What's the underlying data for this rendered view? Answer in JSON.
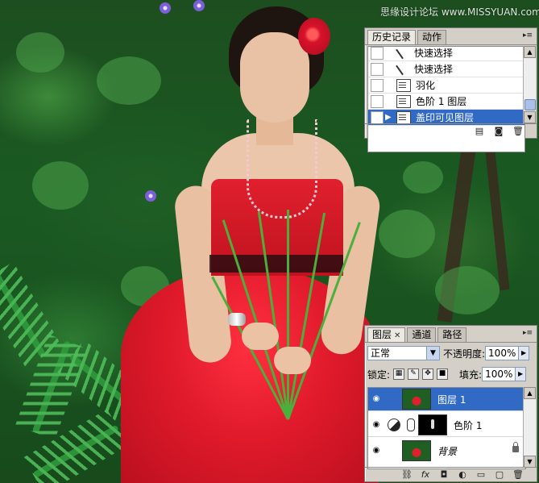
{
  "watermark": "思缘设计论坛 www.MISSYUAN.com",
  "history_panel": {
    "tabs": [
      {
        "label": "历史记录",
        "active": true
      },
      {
        "label": "动作",
        "active": false
      }
    ],
    "items": [
      {
        "label": "快速选择",
        "icon": "magic-wand-icon",
        "selected": false
      },
      {
        "label": "快速选择",
        "icon": "magic-wand-icon",
        "selected": false
      },
      {
        "label": "羽化",
        "icon": "history-state-icon",
        "selected": false
      },
      {
        "label": "色阶 1 图层",
        "icon": "history-state-icon",
        "selected": false
      },
      {
        "label": "盖印可见图层",
        "icon": "history-state-icon",
        "selected": true
      }
    ],
    "footer_icons": [
      "new-document-from-state-icon",
      "camera-snapshot-icon",
      "trash-icon"
    ]
  },
  "layers_panel": {
    "tabs": [
      {
        "label": "图层",
        "active": true,
        "closable": true
      },
      {
        "label": "通道",
        "active": false
      },
      {
        "label": "路径",
        "active": false
      }
    ],
    "blend_mode": "正常",
    "opacity_label": "不透明度:",
    "opacity_value": "100%",
    "lock_label": "锁定:",
    "fill_label": "填充:",
    "fill_value": "100%",
    "layers": [
      {
        "name": "图层 1",
        "selected": true,
        "visible": true
      },
      {
        "name": "色阶 1",
        "selected": false,
        "visible": true,
        "adjustment": true
      },
      {
        "name": "背景",
        "selected": false,
        "visible": true,
        "locked": true
      }
    ],
    "footer_icons": [
      "link-icon",
      "fx-icon",
      "mask-icon",
      "adjustment-icon",
      "group-folder-icon",
      "new-layer-icon",
      "trash-icon"
    ]
  },
  "colors": {
    "selection": "#316ac5",
    "panel_bg": "#d4d0c8"
  }
}
